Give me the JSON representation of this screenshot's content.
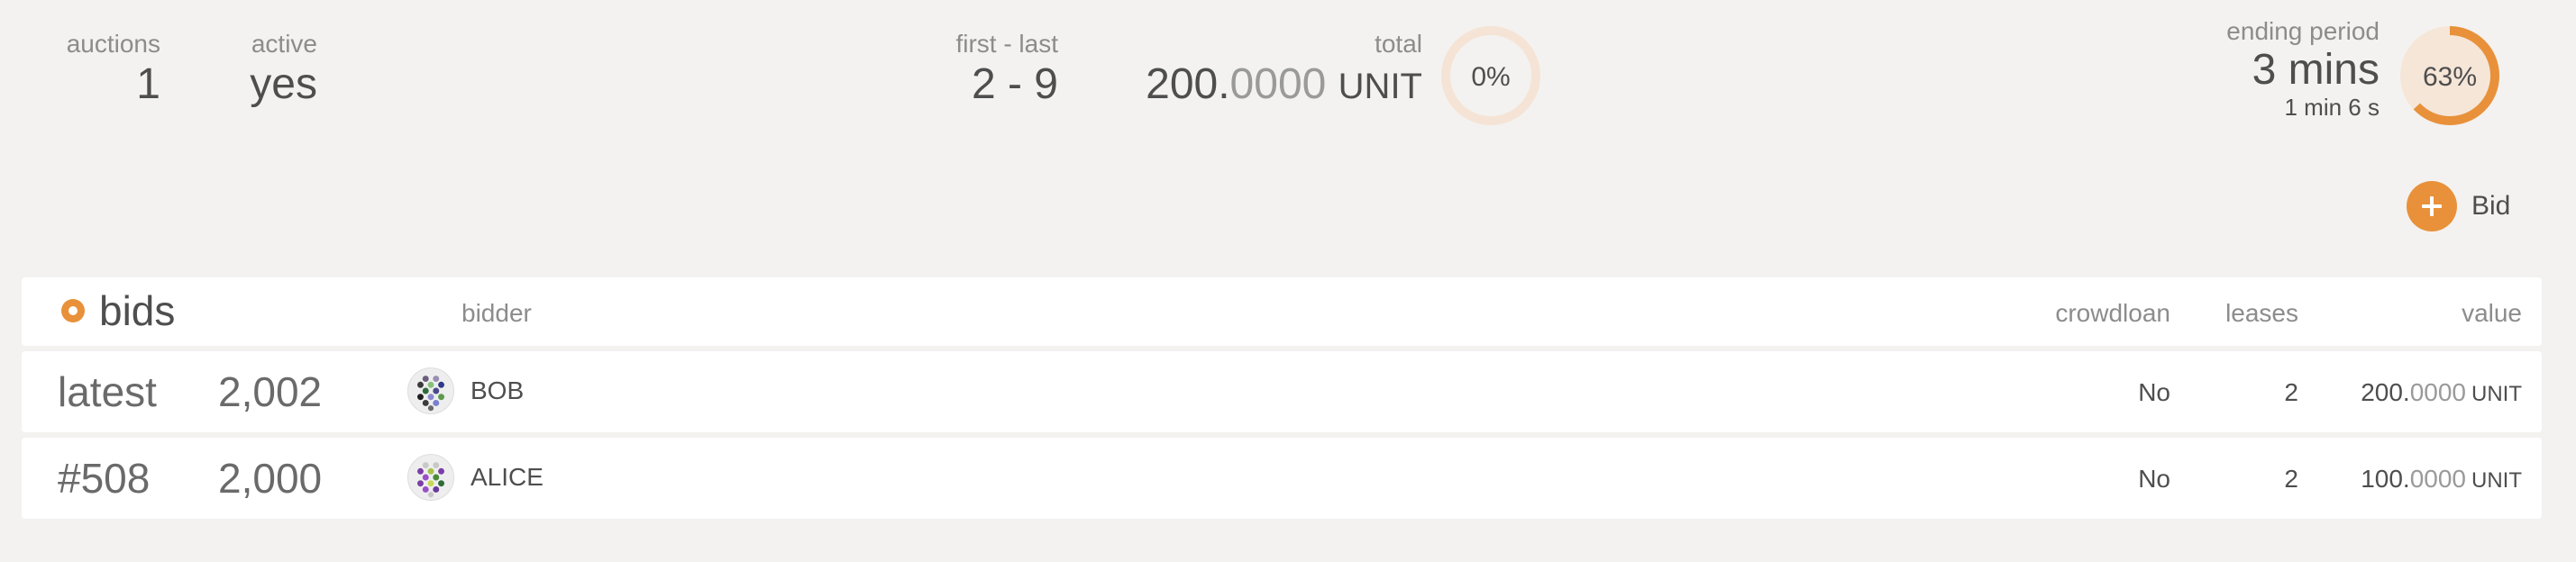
{
  "summary": {
    "auctions": {
      "label": "auctions",
      "value": "1"
    },
    "active": {
      "label": "active",
      "value": "yes"
    },
    "first_last": {
      "label": "first - last",
      "value": "2 - 9"
    },
    "total": {
      "label": "total",
      "value_whole": "200.",
      "value_decimal": "0000",
      "unit": "UNIT",
      "percent_label": "0%",
      "percent": 0
    },
    "ending_period": {
      "label": "ending period",
      "value": "3 mins",
      "remaining": "1 min 6 s",
      "percent_label": "63%",
      "percent": 63
    }
  },
  "bid_button": {
    "label": "Bid",
    "icon": "plus-icon"
  },
  "table": {
    "title": "bids",
    "title_icon": "dot-circle-icon",
    "columns": {
      "bidder": "bidder",
      "crowdloan": "crowdloan",
      "leases": "leases",
      "value": "value"
    },
    "rows": [
      {
        "when": "latest",
        "block": "2,002",
        "bidder": "BOB",
        "crowdloan": "No",
        "leases": "2",
        "value_whole": "200.",
        "value_decimal": "0000",
        "unit": "UNIT"
      },
      {
        "when": "#508",
        "block": "2,000",
        "bidder": "ALICE",
        "crowdloan": "No",
        "leases": "2",
        "value_whole": "100.",
        "value_decimal": "0000",
        "unit": "UNIT"
      }
    ]
  },
  "colors": {
    "accent": "#e8913a",
    "accent_light": "#f6e6d8",
    "background": "#f3f2f0",
    "card": "#ffffff"
  }
}
